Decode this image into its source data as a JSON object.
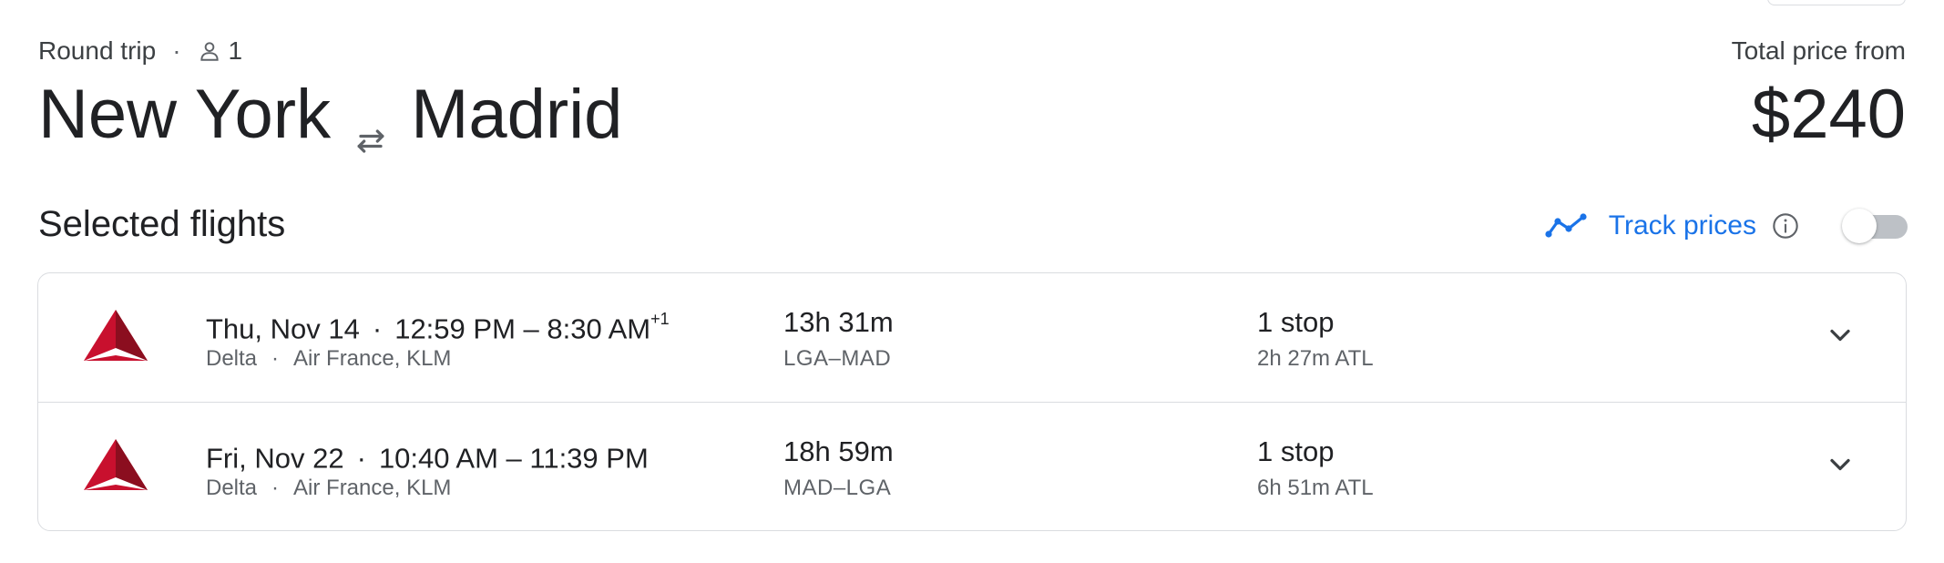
{
  "header": {
    "trip_type": "Round trip",
    "separator": "·",
    "passenger_count": "1",
    "origin": "New York",
    "destination": "Madrid",
    "price_label": "Total price from",
    "price": "$240"
  },
  "selected_flights": {
    "title": "Selected flights",
    "track_prices_label": "Track prices",
    "track_prices_enabled": false
  },
  "flights": [
    {
      "date": "Thu, Nov 14",
      "separator": "·",
      "times": "12:59 PM – 8:30 AM",
      "day_offset": "+1",
      "operator": "Delta",
      "carrier_separator": "·",
      "partners": "Air France, KLM",
      "duration": "13h 31m",
      "route": "LGA–MAD",
      "stops": "1 stop",
      "layover": "2h 27m ATL"
    },
    {
      "date": "Fri, Nov 22",
      "separator": "·",
      "times": "10:40 AM – 11:39 PM",
      "day_offset": "",
      "operator": "Delta",
      "carrier_separator": "·",
      "partners": "Air France, KLM",
      "duration": "18h 59m",
      "route": "MAD–LGA",
      "stops": "1 stop",
      "layover": "6h 51m ATL"
    }
  ],
  "colors": {
    "accent_blue": "#1a73e8",
    "text_primary": "#202124",
    "text_secondary": "#5f6368",
    "border": "#dadce0",
    "delta_red": "#c8102e",
    "delta_dark_red": "#8b0e1f",
    "toggle_off": "#bdc1c6"
  },
  "icons": {
    "passenger": "person-icon",
    "swap": "swap-arrows-icon",
    "trend": "price-trend-icon",
    "info": "info-icon",
    "expand": "chevron-down-icon",
    "airline": "delta-logo-icon"
  }
}
